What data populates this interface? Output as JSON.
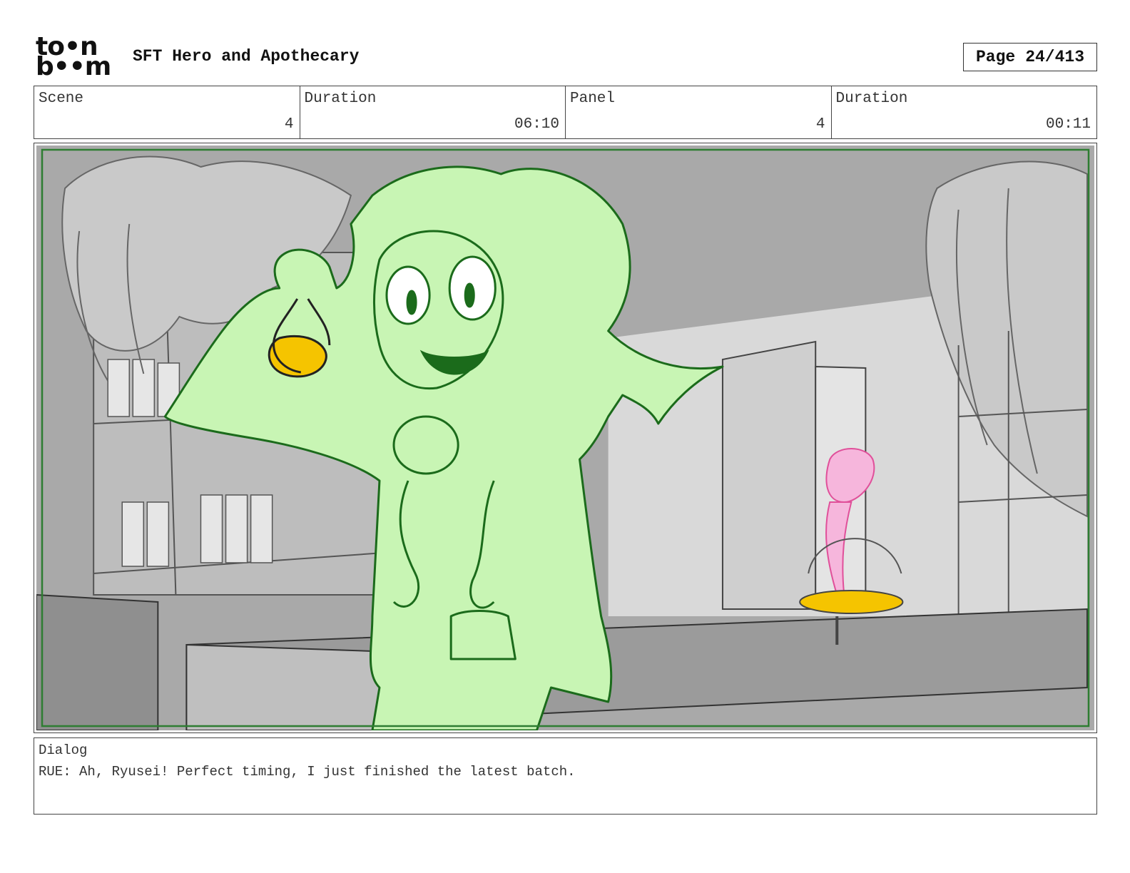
{
  "header": {
    "logo_line1": "to•n",
    "logo_line2": "b••m",
    "project_title": "SFT Hero and Apothecary",
    "page_label": "Page",
    "page_value": "24/413"
  },
  "info": {
    "scene_label": "Scene",
    "scene_value": "4",
    "scene_duration_label": "Duration",
    "scene_duration_value": "06:10",
    "panel_label": "Panel",
    "panel_value": "4",
    "panel_duration_label": "Duration",
    "panel_duration_value": "00:11"
  },
  "dialog": {
    "label": "Dialog",
    "text": "RUE: Ah, Ryusei! Perfect timing, I just finished the latest batch."
  },
  "colors": {
    "safe_frame": "#2e7d32",
    "character_fill": "#c8f5b4",
    "character_line": "#1b6b1b",
    "potion": "#f5c400",
    "pink_figure": "#f3a0d0",
    "background_gray": "#a8a8a8"
  }
}
